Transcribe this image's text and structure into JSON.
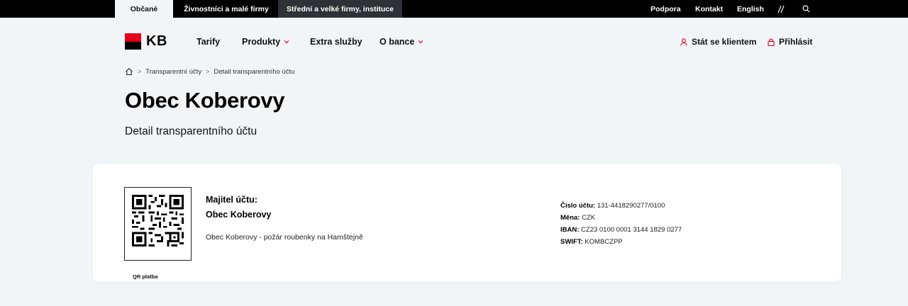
{
  "topbar": {
    "segments": [
      "Občané",
      "Živnostníci a malé firmy",
      "Střední a velké firmy, instituce"
    ],
    "links": [
      "Podpora",
      "Kontakt",
      "English"
    ],
    "icons": [
      "accessibility-icon",
      "search-icon"
    ]
  },
  "nav": {
    "logo_text": "KB",
    "items": [
      "Tarify",
      "Produkty",
      "Extra služby",
      "O bance"
    ],
    "become_client": "Stát se klientem",
    "login": "Přihlásit"
  },
  "breadcrumb": [
    "Transparentní účty",
    "Detail transparentního účtu"
  ],
  "page": {
    "title": "Obec Koberovy",
    "subtitle": "Detail transparentního účtu"
  },
  "card": {
    "qr_label": "QR platba",
    "owner_heading": "Majitel účtu:",
    "owner_name": "Obec Koberovy",
    "description": "Obec Koberovy - požár roubenky na Hamštejně",
    "account": {
      "number_label": "Číslo účtu:",
      "number": "131-4418290277/0100",
      "currency_label": "Měna:",
      "currency": "CZK",
      "iban_label": "IBAN:",
      "iban": "CZ23 0100 0001 3144 1829 0277",
      "swift_label": "SWIFT:",
      "swift": "KOMBCZPP"
    }
  },
  "colors": {
    "brand_red": "#e2001a",
    "topbar": "#000000",
    "background": "#f2f5f8"
  }
}
